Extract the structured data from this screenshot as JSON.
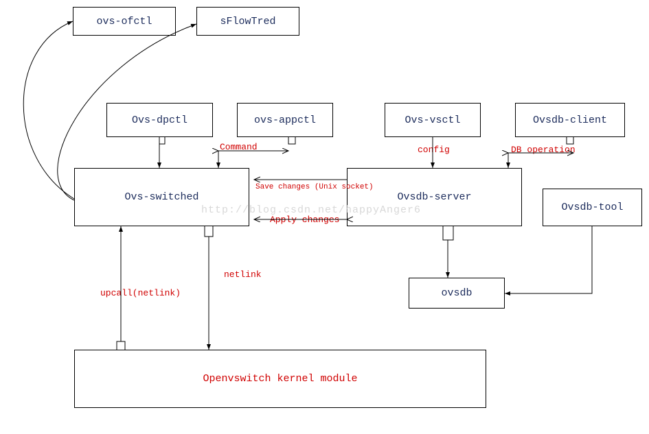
{
  "boxes": {
    "ovs_ofctl": "ovs-ofctl",
    "sflowtred": "sFlowTred",
    "ovs_dpctl": "Ovs-dpctl",
    "ovs_appctl": "ovs-appctl",
    "ovs_vsctl": "Ovs-vsctl",
    "ovsdb_client": "Ovsdb-client",
    "ovs_switched": "Ovs-switched",
    "ovsdb_server": "Ovsdb-server",
    "ovsdb_tool": "Ovsdb-tool",
    "ovsdb": "ovsdb",
    "kernel_module": "Openvswitch kernel module"
  },
  "labels": {
    "command": "Command",
    "config": "config",
    "db_operation": "DB operation",
    "save_changes": "Save changes (Unix socket)",
    "apply_changes": "Apply changes",
    "netlink": "netlink",
    "upcall": "upcall(netlink)"
  },
  "watermark": "http://blog.csdn.net/happyAnger6"
}
